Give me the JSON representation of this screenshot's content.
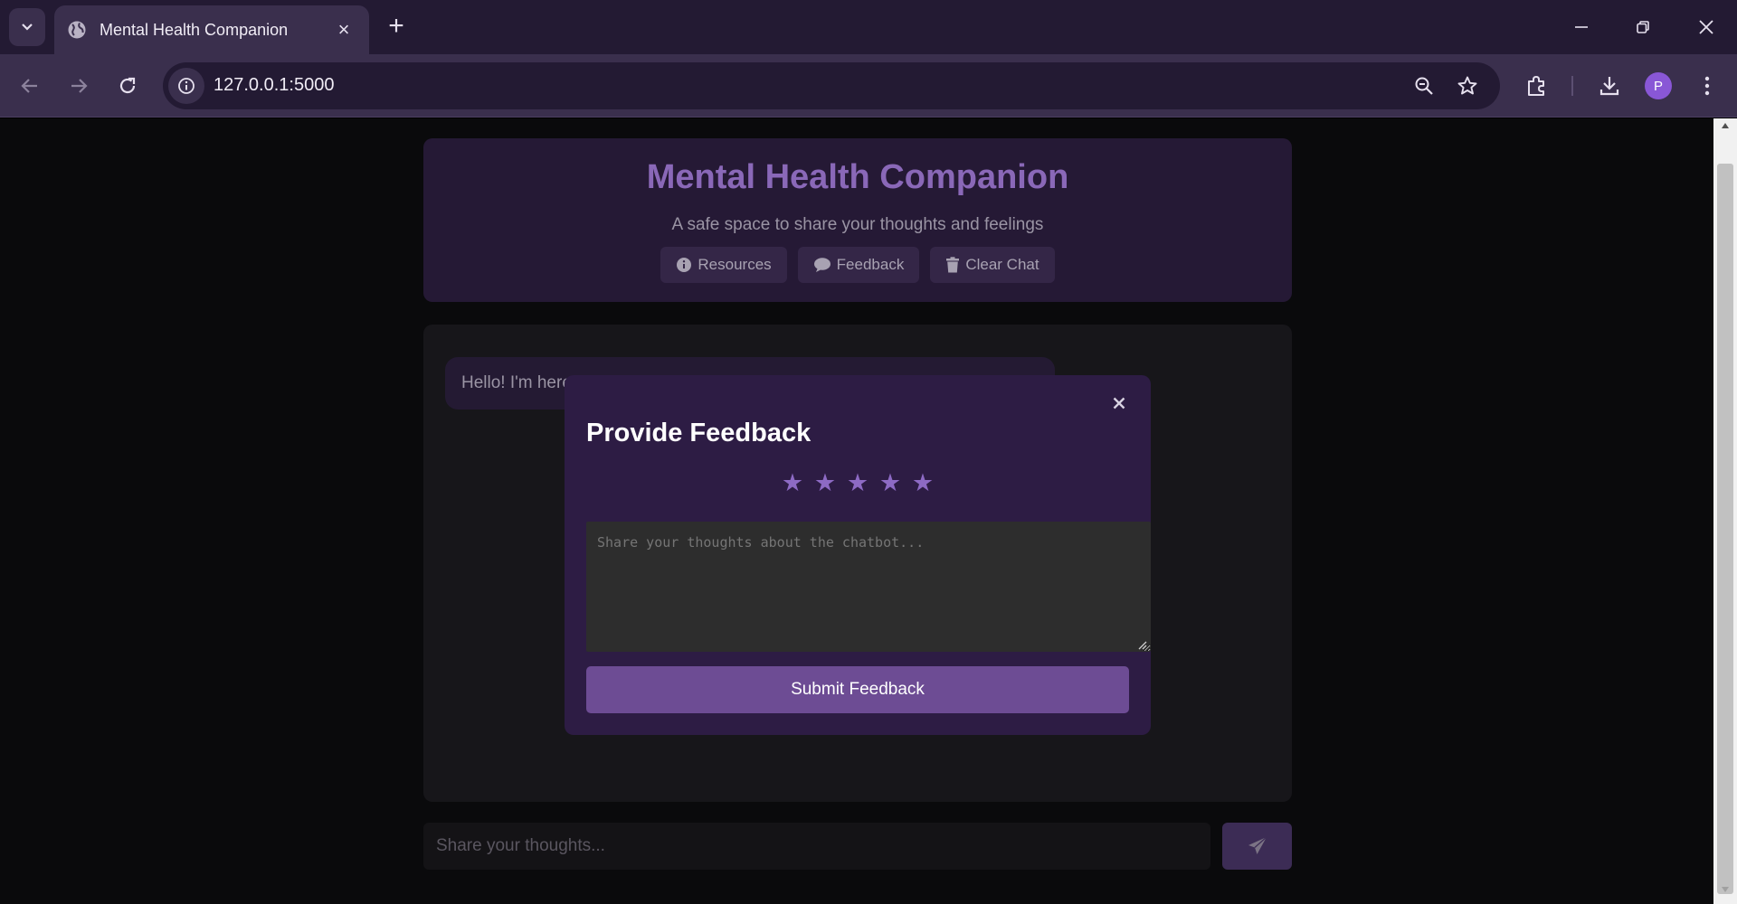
{
  "browser": {
    "tab_title": "Mental Health Companion",
    "url": "127.0.0.1:5000",
    "profile_initial": "P"
  },
  "app": {
    "title": "Mental Health Companion",
    "subtitle": "A safe space to share your thoughts and feelings",
    "buttons": {
      "resources": "Resources",
      "feedback": "Feedback",
      "clear_chat": "Clear Chat"
    },
    "bot_message": "Hello! I'm here",
    "input_placeholder": "Share your thoughts..."
  },
  "modal": {
    "title": "Provide Feedback",
    "stars": [
      "★",
      "★",
      "★",
      "★",
      "★"
    ],
    "textarea_placeholder": "Share your thoughts about the chatbot...",
    "submit_label": "Submit Feedback"
  },
  "colors": {
    "accent": "#6d4c94",
    "star": "#8d6ac4",
    "header_title": "#8a68b8"
  },
  "icons": {
    "resources": "info-circle-icon",
    "feedback": "comment-icon",
    "clear_chat": "trash-icon",
    "send": "paper-plane-icon"
  }
}
